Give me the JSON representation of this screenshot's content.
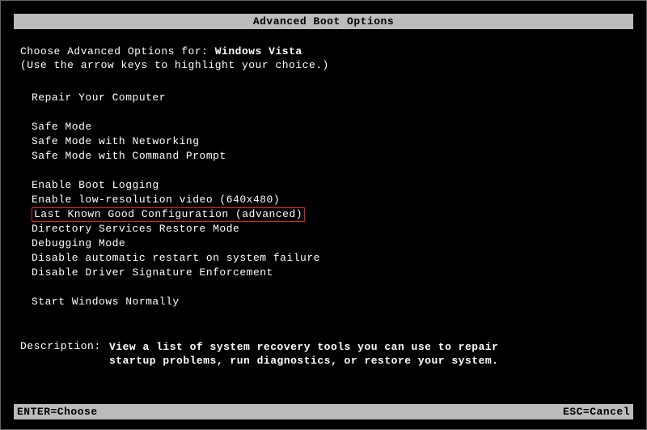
{
  "title": "Advanced Boot Options",
  "prompt_prefix": "Choose Advanced Options for: ",
  "os_name": "Windows Vista",
  "hint": "(Use the arrow keys to highlight your choice.)",
  "menu": {
    "repair": "Repair Your Computer",
    "safe_mode": "Safe Mode",
    "safe_mode_net": "Safe Mode with Networking",
    "safe_mode_cmd": "Safe Mode with Command Prompt",
    "boot_logging": "Enable Boot Logging",
    "low_res": "Enable low-resolution video (640x480)",
    "last_known": "Last Known Good Configuration (advanced)",
    "ds_restore": "Directory Services Restore Mode",
    "debugging": "Debugging Mode",
    "disable_auto_restart": "Disable automatic restart on system failure",
    "disable_driver_sig": "Disable Driver Signature Enforcement",
    "start_normally": "Start Windows Normally"
  },
  "description": {
    "label": "Description:",
    "text": "View a list of system recovery tools you can use to repair startup problems, run diagnostics, or restore your system."
  },
  "footer": {
    "enter": "ENTER=Choose",
    "esc": "ESC=Cancel"
  },
  "highlighted_item": "last_known"
}
